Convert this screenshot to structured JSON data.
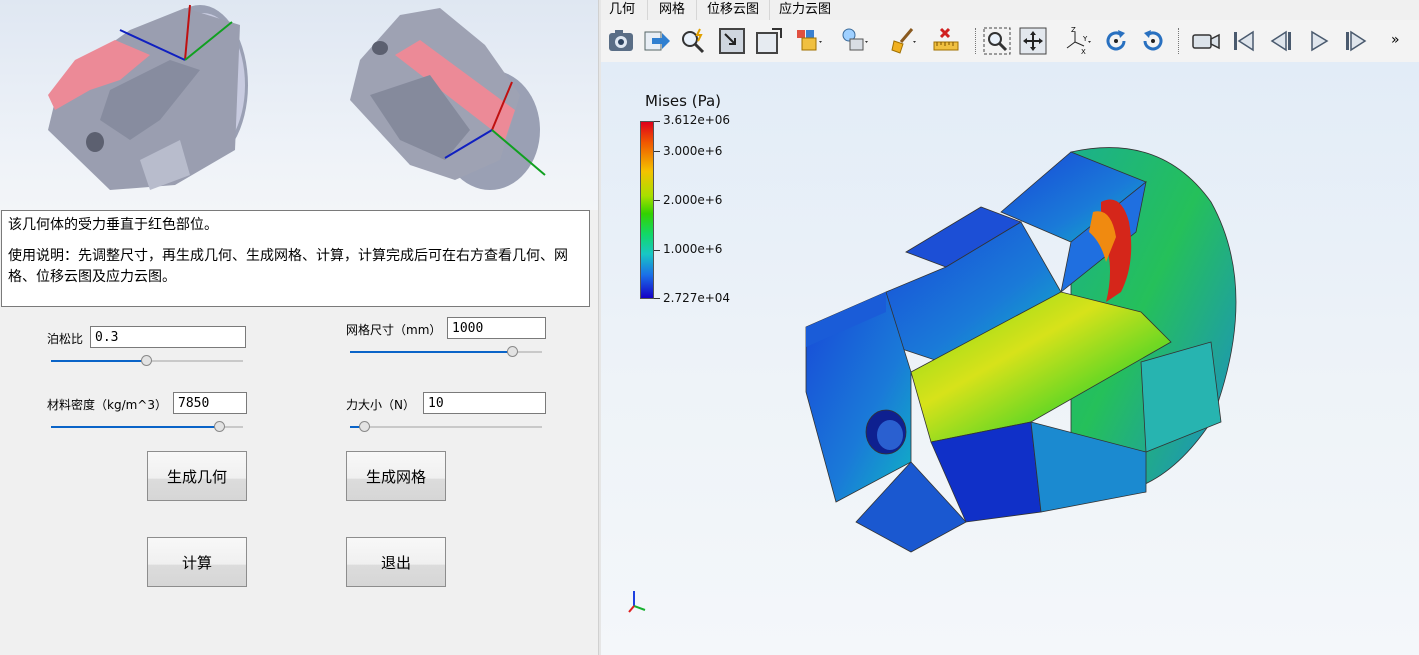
{
  "left_panel": {
    "description_line1": "该几何体的受力垂直于红色部位。",
    "description_line2": "使用说明：先调整尺寸，再生成几何、生成网格、计算，计算完成后可在右方查看几何、网格、位移云图及应力云图。",
    "params": {
      "poisson": {
        "label": "泊松比",
        "value": "0.3",
        "slider_fraction": 0.5
      },
      "mesh_size": {
        "label": "网格尺寸（mm）",
        "value": "1000",
        "slider_fraction": 0.85
      },
      "density": {
        "label": "材料密度（kg/m^3）",
        "value": "7850",
        "slider_fraction": 0.88
      },
      "force": {
        "label": "力大小（N）",
        "value": "10",
        "slider_fraction": 0.08
      }
    },
    "buttons": {
      "gen_geometry": "生成几何",
      "gen_mesh": "生成网格",
      "compute": "计算",
      "exit": "退出"
    }
  },
  "right_panel": {
    "tabs": [
      "几何",
      "网格",
      "位移云图",
      "应力云图"
    ],
    "active_tab": "应力云图",
    "toolbar_icons": [
      "camera-icon",
      "export-arrow-icon",
      "zoom-interactive-icon",
      "fit-selection-icon",
      "maximize-icon",
      "shapes-color-icon",
      "light-icon",
      "clear-broom-icon",
      "measure-ruler-icon",
      "zoom-box-icon",
      "pan-icon",
      "axes-orient-icon",
      "rotate-cw-icon",
      "rotate-ccw-icon",
      "video-camera-icon",
      "first-frame-icon",
      "prev-frame-icon",
      "play-icon",
      "last-frame-icon"
    ],
    "overflow_label": "»",
    "legend": {
      "title": "Mises (Pa)",
      "max": "3.612e+06",
      "ticks": [
        "3.000e+6",
        "2.000e+6",
        "1.000e+6"
      ],
      "min": "2.727e+04"
    },
    "colors": {
      "max": "#e0001b",
      "mid": "#33d200",
      "min": "#1400c6",
      "accent": "#0a64c8"
    }
  }
}
